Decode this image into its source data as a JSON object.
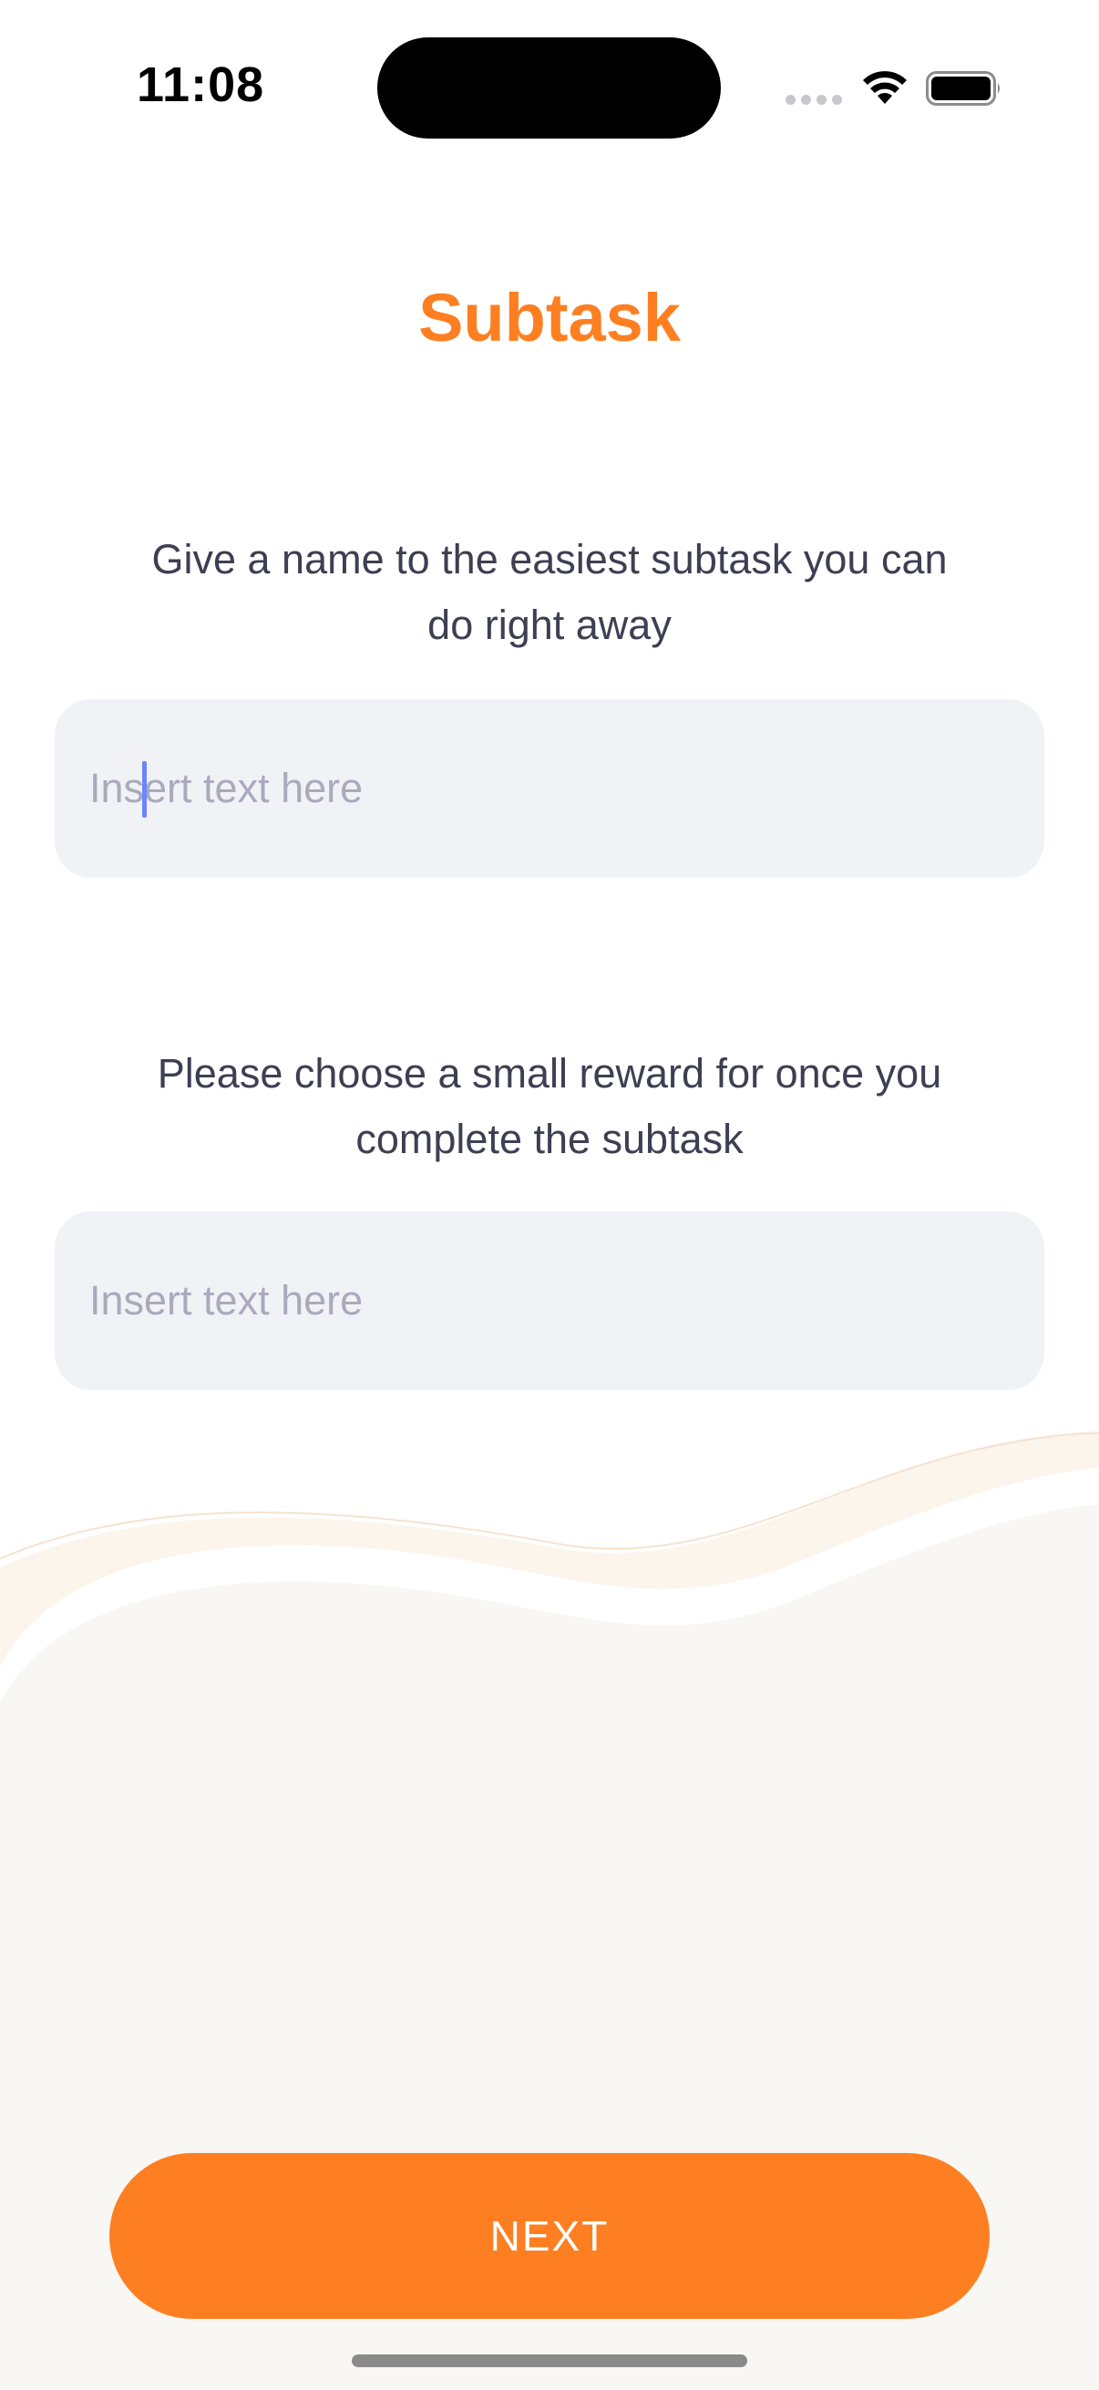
{
  "status_bar": {
    "time": "11:08",
    "icons": [
      "signal-icon",
      "wifi-icon",
      "battery-icon"
    ]
  },
  "screen": {
    "title": "Subtask"
  },
  "form": {
    "subtask_prompt": "Give a name to the easiest subtask you can do right away",
    "subtask_input": {
      "value": "",
      "placeholder": "Insert text here",
      "focused": true
    },
    "reward_prompt": "Please choose a small reward for once you complete the subtask",
    "reward_input": {
      "value": "",
      "placeholder": "Insert text here"
    }
  },
  "actions": {
    "next_label": "NEXT"
  },
  "colors": {
    "accent": "#fd7f21",
    "text": "#3d3f52",
    "field_background": "#f1f2f6",
    "placeholder": "#a9aabb",
    "wave_background": "#f8f7f4",
    "caret": "#6b84ff"
  }
}
